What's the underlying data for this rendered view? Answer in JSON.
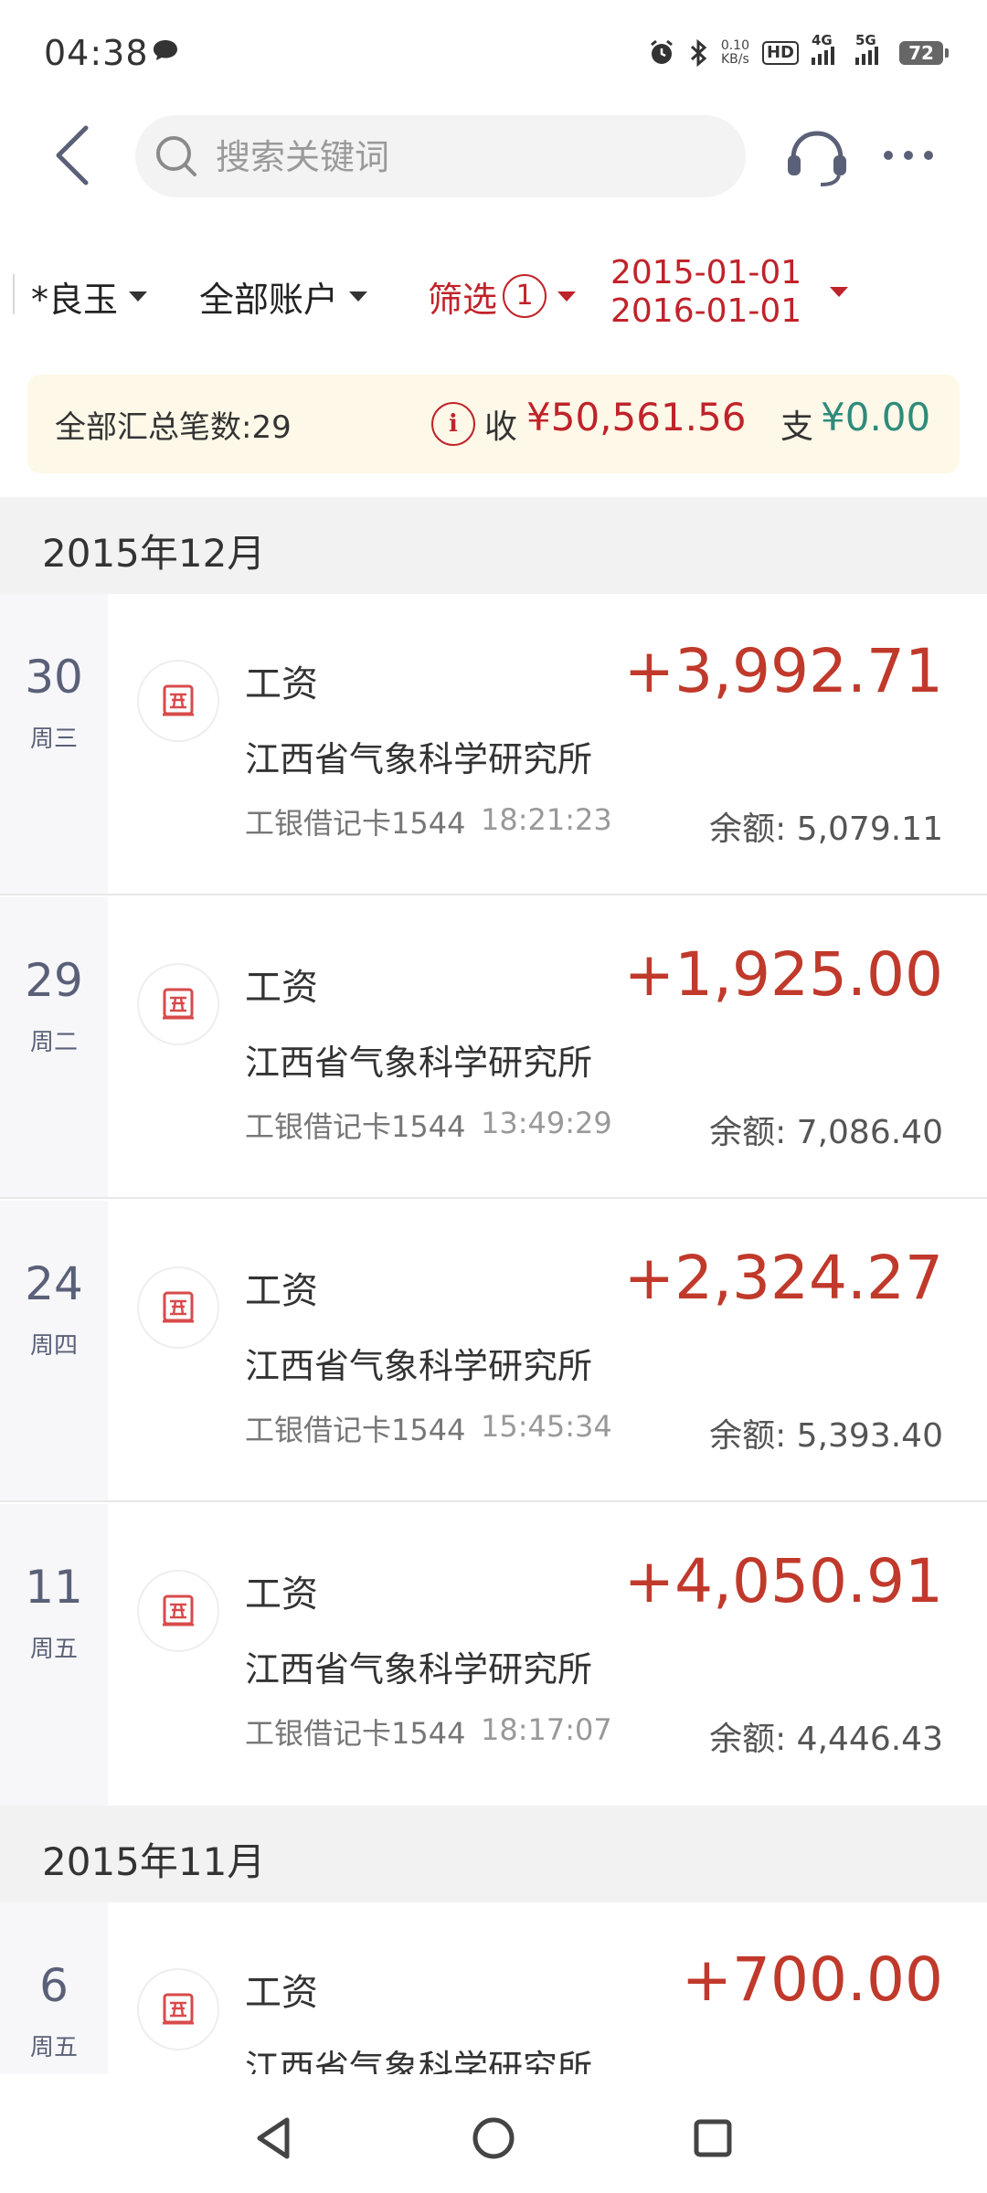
{
  "status_bar": {
    "time": "04:38",
    "net_speed_value": "0.10",
    "net_speed_unit": "KB/s",
    "hd_label": "HD",
    "sim1_label": "4G",
    "sim2_label": "5G",
    "battery": "72"
  },
  "header": {
    "search_placeholder": "搜索关键词"
  },
  "filters": {
    "member": "*良玉",
    "account": "全部账户",
    "filter_label": "筛选",
    "filter_count": "1",
    "date_start": "2015-01-01",
    "date_end": "2016-01-01"
  },
  "summary": {
    "count_text": "全部汇总笔数:29",
    "info_glyph": "i",
    "income_label": "收",
    "income_value": "¥50,561.56",
    "expense_label": "支",
    "expense_value": "¥0.00"
  },
  "months": [
    {
      "label": "2015年12月",
      "transactions": [
        {
          "day": "30",
          "weekday": "周三",
          "title": "工资",
          "payee": "江西省气象科学研究所",
          "account": "工银借记卡1544",
          "time": "18:21:23",
          "amount": "+3,992.71",
          "balance": "余额: 5,079.11"
        },
        {
          "day": "29",
          "weekday": "周二",
          "title": "工资",
          "payee": "江西省气象科学研究所",
          "account": "工银借记卡1544",
          "time": "13:49:29",
          "amount": "+1,925.00",
          "balance": "余额: 7,086.40"
        },
        {
          "day": "24",
          "weekday": "周四",
          "title": "工资",
          "payee": "江西省气象科学研究所",
          "account": "工银借记卡1544",
          "time": "15:45:34",
          "amount": "+2,324.27",
          "balance": "余额: 5,393.40"
        },
        {
          "day": "11",
          "weekday": "周五",
          "title": "工资",
          "payee": "江西省气象科学研究所",
          "account": "工银借记卡1544",
          "time": "18:17:07",
          "amount": "+4,050.91",
          "balance": "余额: 4,446.43"
        }
      ]
    },
    {
      "label": "2015年11月",
      "transactions": [
        {
          "day": "6",
          "weekday": "周五",
          "title": "工资",
          "payee": "江西省气象科学研究所",
          "amount": "+700.00"
        }
      ]
    }
  ],
  "colors": {
    "income_red": "#c0392b",
    "expense_green": "#2e8b7a",
    "accent_red": "#c0232a",
    "summary_bg": "#fdf8e8"
  }
}
